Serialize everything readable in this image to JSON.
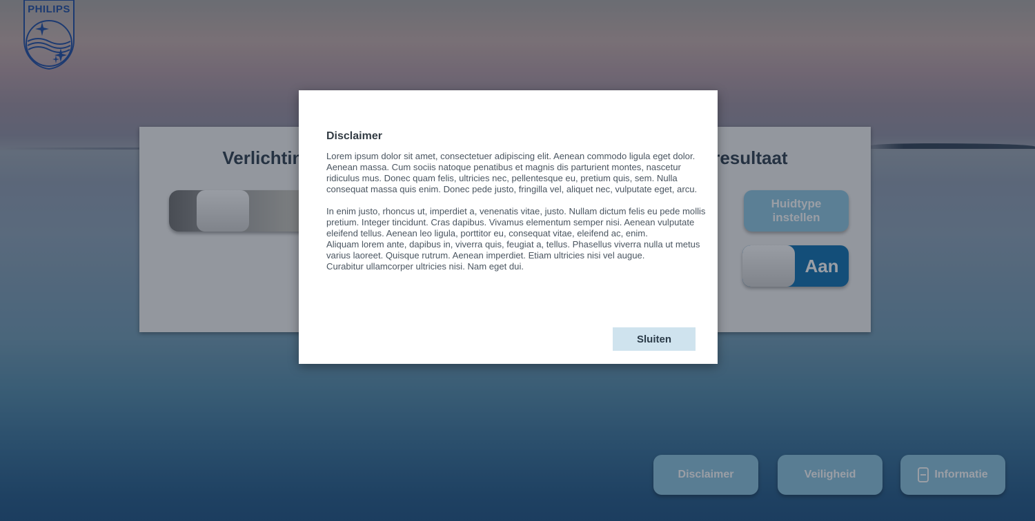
{
  "brand": {
    "name": "PHILIPS"
  },
  "panel": {
    "title": "Verlichting aanpassen aan huidtype voor behandeling en resultaat",
    "skin_type_button": "Huidtype instellen",
    "toggle_label": "Aan"
  },
  "bottom_nav": {
    "disclaimer": "Disclaimer",
    "safety": "Veiligheid",
    "information": "Informatie"
  },
  "modal": {
    "title": "Disclaimer",
    "paragraph1": "Lorem ipsum dolor sit amet, consectetuer adipiscing elit. Aenean commodo ligula eget dolor. Aenean massa. Cum sociis natoque penatibus et magnis dis parturient montes, nascetur ridiculus mus. Donec quam felis, ultricies nec, pellentesque eu, pretium quis, sem. Nulla consequat massa quis enim. Donec pede justo, fringilla vel, aliquet nec, vulputate eget, arcu.",
    "paragraph2_line1": "In enim justo, rhoncus ut, imperdiet a, venenatis vitae, justo. Nullam dictum  felis eu pede mollis pretium. Integer tincidunt. Cras dapibus. Vivamus elementum semper nisi. Aenean vulputate eleifend tellus. Aenean leo ligula, porttitor eu, consequat vitae, eleifend ac, enim.",
    "paragraph2_line2": "Aliquam lorem ante, dapibus in, viverra quis, feugiat a, tellus. Phasellus viverra nulla ut metus varius laoreet. Quisque rutrum. Aenean imperdiet. Etiam ultricies nisi vel augue.",
    "paragraph2_line3": "Curabitur ullamcorper ultricies nisi. Nam eget dui.",
    "close_label": "Sluiten"
  },
  "colors": {
    "accent": "#0a6eb0",
    "button_light": "#89c3df",
    "modal_button": "#cfe3ee"
  }
}
